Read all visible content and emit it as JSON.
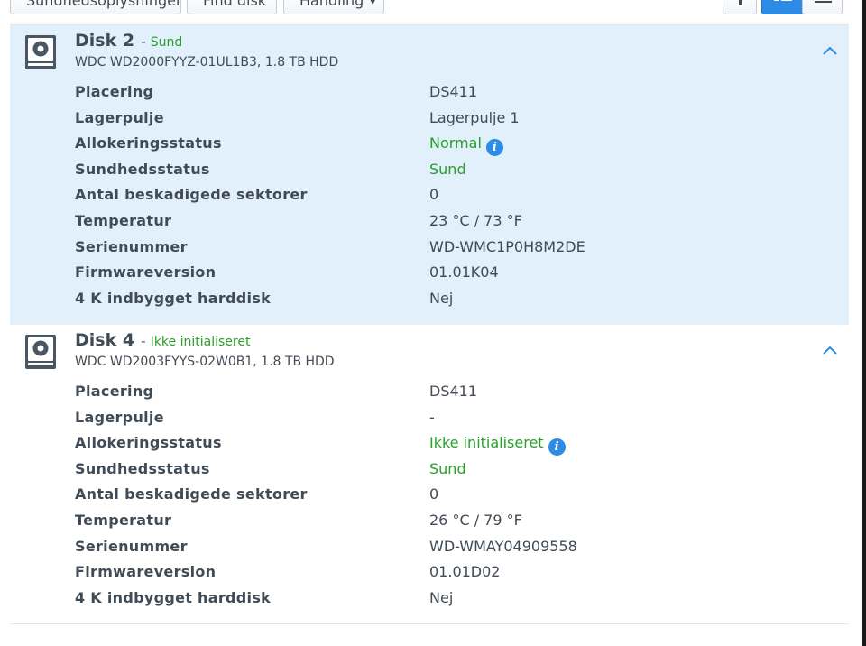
{
  "toolbar": {
    "health_info_label": "Sundhedsoplysninger",
    "find_disk_label": "Find disk",
    "action_label": "Handling"
  },
  "disks": [
    {
      "name": "Disk 2",
      "separator": "-",
      "status": "Sund",
      "model": "WDC WD2000FYYZ-01UL1B3, 1.8 TB HDD",
      "properties": [
        {
          "label": "Placering",
          "value": "DS411"
        },
        {
          "label": "Lagerpulje",
          "value": "Lagerpulje 1"
        },
        {
          "label": "Allokeringsstatus",
          "value": "Normal"
        },
        {
          "label": "Sundhedsstatus",
          "value": "Sund"
        },
        {
          "label": "Antal beskadigede sektorer",
          "value": "0"
        },
        {
          "label": "Temperatur",
          "value": "23 °C / 73 °F"
        },
        {
          "label": "Serienummer",
          "value": "WD-WMC1P0H8M2DE"
        },
        {
          "label": "Firmwareversion",
          "value": "01.01K04"
        },
        {
          "label": "4 K indbygget harddisk",
          "value": "Nej"
        }
      ]
    },
    {
      "name": "Disk 4",
      "separator": "-",
      "status": "Ikke initialiseret",
      "model": "WDC WD2003FYYS-02W0B1, 1.8 TB HDD",
      "properties": [
        {
          "label": "Placering",
          "value": "DS411"
        },
        {
          "label": "Lagerpulje",
          "value": "-"
        },
        {
          "label": "Allokeringsstatus",
          "value": "Ikke initialiseret"
        },
        {
          "label": "Sundhedsstatus",
          "value": "Sund"
        },
        {
          "label": "Antal beskadigede sektorer",
          "value": "0"
        },
        {
          "label": "Temperatur",
          "value": "26 °C / 79 °F"
        },
        {
          "label": "Serienummer",
          "value": "WD-WMAY04909558"
        },
        {
          "label": "Firmwareversion",
          "value": "01.01D02"
        },
        {
          "label": "4 K indbygget harddisk",
          "value": "Nej"
        }
      ]
    }
  ],
  "colors": {
    "status_green": "#27a027",
    "selected_row": "#e1f0fb",
    "accent_blue": "#2c8ce6"
  },
  "icons": {
    "disk": "hard-disk-icon",
    "collapse": "chevron-up-icon",
    "info": "info-icon",
    "view_toggle_1": "info-view-icon",
    "view_toggle_2": "detail-list-icon",
    "view_toggle_3": "compact-list-icon"
  }
}
